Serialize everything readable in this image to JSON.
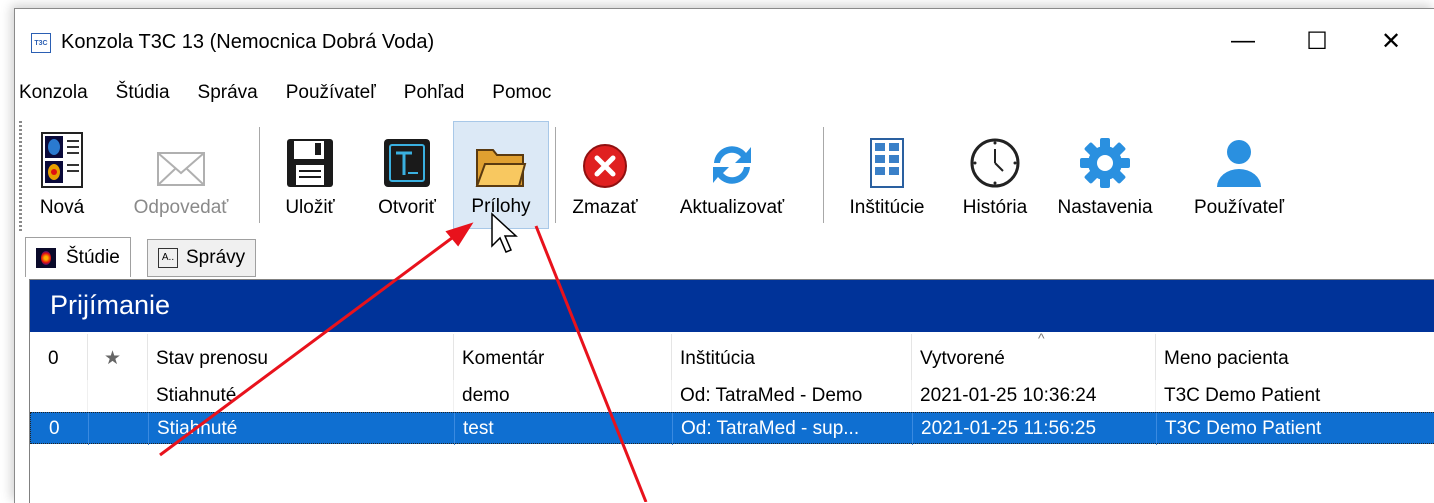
{
  "window": {
    "title": "Konzola T3C 13 (Nemocnica Dobrá Voda)",
    "app_icon": "T3C",
    "controls": {
      "minimize": "—",
      "maximize": "☐",
      "close": "✕"
    }
  },
  "menu": [
    "Konzola",
    "Štúdia",
    "Správa",
    "Používateľ",
    "Pohľad",
    "Pomoc"
  ],
  "toolbar": {
    "new": "Nová",
    "reply": "Odpovedať",
    "save": "Uložiť",
    "open": "Otvoriť",
    "attachments": "Prílohy",
    "delete": "Zmazať",
    "refresh": "Aktualizovať",
    "institutions": "Inštitúcie",
    "history": "História",
    "settings": "Nastavenia",
    "user": "Používateľ"
  },
  "tabs": {
    "studies": "Štúdie",
    "reports": "Správy",
    "reports_icon": "A.."
  },
  "panel": {
    "title": "Prijímanie"
  },
  "table": {
    "headers": {
      "attachment": "0",
      "star": "★",
      "status": "Stav prenosu",
      "comment": "Komentár",
      "institution": "Inštitúcia",
      "created": "Vytvorené",
      "sort_indicator": "^",
      "patient": "Meno pacienta"
    },
    "rows": [
      {
        "attachment": "",
        "star": "",
        "status": "Stiahnuté",
        "comment": "demo",
        "institution": "Od: TatraMed - Demo",
        "created": "2021-01-25 10:36:24",
        "patient": "T3C Demo Patient"
      },
      {
        "attachment": "0",
        "star": "",
        "status": "Stiahnuté",
        "comment": "test",
        "institution": "Od: TatraMed - sup...",
        "created": "2021-01-25 11:56:25",
        "patient": "T3C Demo Patient"
      }
    ]
  },
  "colors": {
    "header_bg": "#003399",
    "selection": "#0f6fd1",
    "annotation": "#e8121c"
  }
}
